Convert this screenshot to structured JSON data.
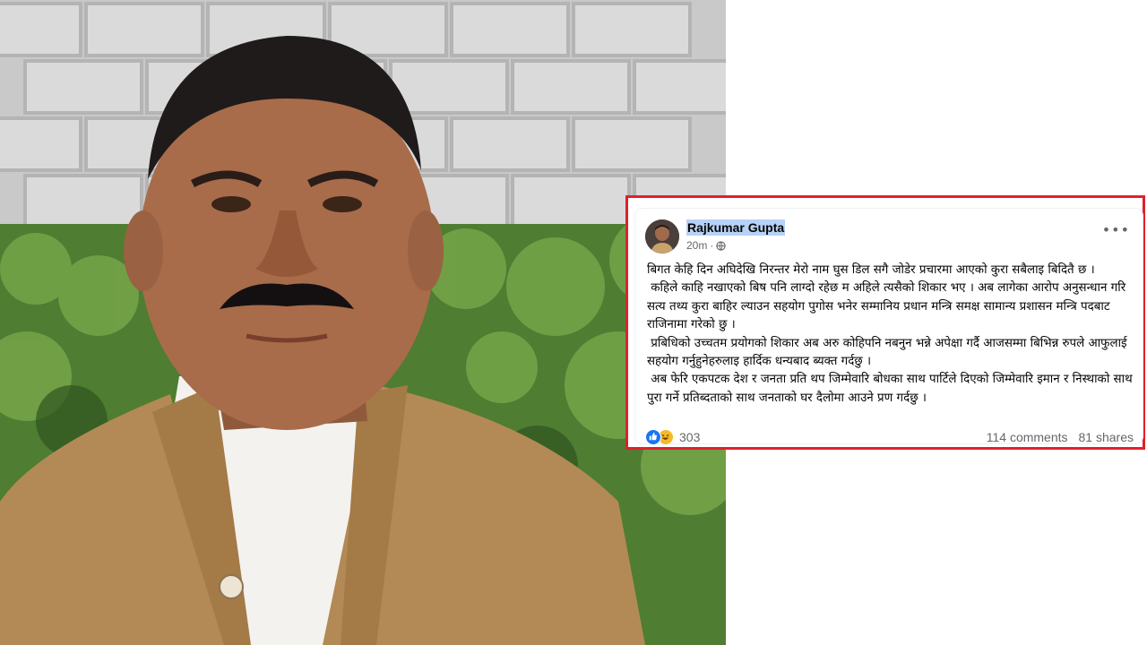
{
  "post": {
    "author": "Rajkumar Gupta",
    "time": "20m",
    "separator": "·",
    "privacy_icon": "globe-icon",
    "more_icon": "more-options-icon",
    "more_label": "•••",
    "paragraphs": [
      "बिगत केहि दिन अघिदेखि निरन्तर मेरो नाम घुस डिल सगै जोडेर प्रचारमा आएको कुरा सबैलाइ बिदितै छ ।",
      " कहिले काहि नखाएको बिष पनि लाग्दो रहेछ म अहिले त्यसैको शिकार भए । अब लागेका आरोप अनुसन्धान गरि सत्य तथ्य कुरा बाहिर ल्याउन सहयोग पुगोस भनेर सम्मानिय प्रधान मन्त्रि समक्ष सामान्य प्रशासन मन्त्रि पदबाट राजिनामा गरेको छु ।",
      " प्रबिधिको उच्चतम प्रयोगको शिकार अब अरु कोहिपनि नबनुन भन्ने अपेक्षा गर्दै आजसम्मा बिभिन्न रुपले आफुलाई सहयोग गर्नुहुनेहरुलाइ हार्दिक धन्यबाद ब्यक्त गर्दछु ।",
      " अब फेरि एकपटक देश र जनता प्रति थप जिम्मेवारि बोधका साथ पार्टिले दिएको जिम्मेवारि इमान र निस्थाको साथ पुरा गर्ने प्रतिब्दताको साथ जनताको घर दैलोमा आउने प्रण गर्दछु ।"
    ],
    "reactions_count": "303",
    "reaction_icons": [
      "like-icon",
      "haha-icon"
    ],
    "comments": "114 comments",
    "shares": "81 shares"
  },
  "colors": {
    "highlight_border": "#e0202c",
    "name_highlight": "#b7d2f6",
    "like_blue": "#1877f2",
    "haha_yellow": "#f7b928"
  }
}
